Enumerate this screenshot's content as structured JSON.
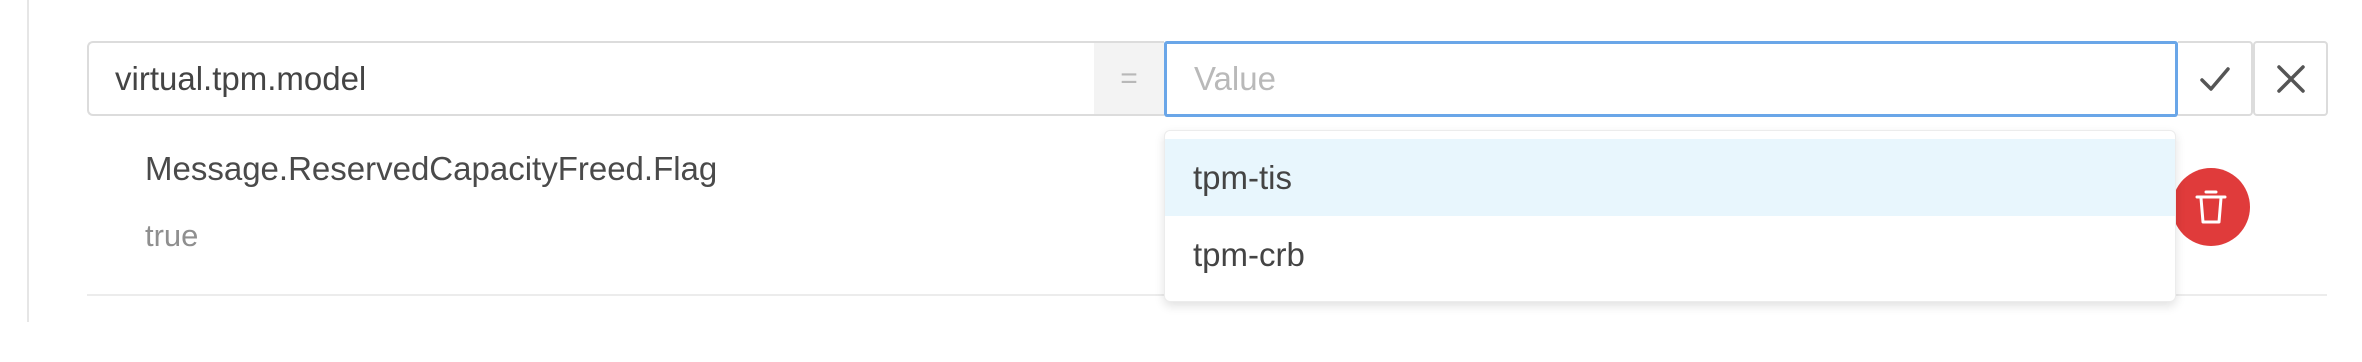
{
  "editor": {
    "key_value": "virtual.tpm.model",
    "operator": "=",
    "value_placeholder": "Value",
    "value_text": ""
  },
  "icons": {
    "confirm": "check-icon",
    "cancel": "close-icon",
    "delete": "trash-icon"
  },
  "colors": {
    "focus_border": "#6aa6e8",
    "delete_button": "#e03b3b",
    "dropdown_active": "#e8f6fd"
  },
  "metadata_row": {
    "key": "Message.ReservedCapacityFreed.Flag",
    "value": "true"
  },
  "suggestions": {
    "items": [
      {
        "label": "tpm-tis"
      },
      {
        "label": "tpm-crb"
      }
    ],
    "highlighted": "tpm-tis"
  }
}
